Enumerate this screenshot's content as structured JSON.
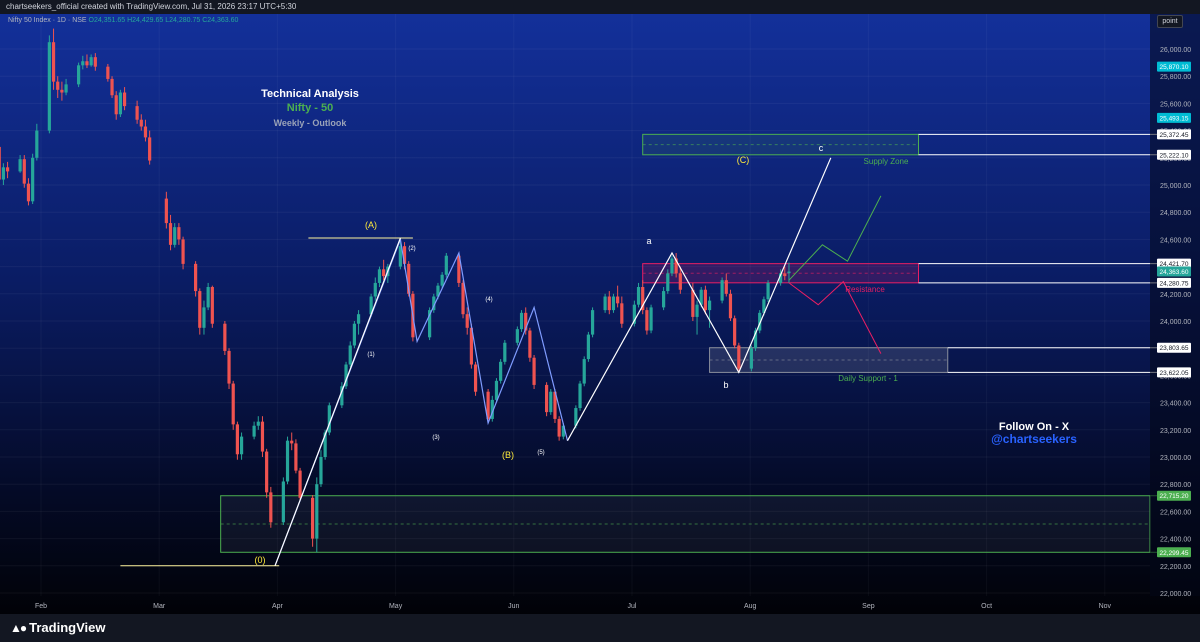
{
  "header": {
    "creator": "chartseekers_official created with TradingView.com, Jul 31, 2026 23:17 UTC+5:30",
    "symbol": "Nifty 50 Index · 1D · NSE",
    "ohlc": "O24,351.65 H24,429.65 L24,280.75 C24,363.60",
    "scale_button": "point"
  },
  "branding": {
    "logo": "TradingView"
  },
  "annotations": {
    "title": "Technical Analysis",
    "subtitle": "Nifty - 50",
    "outlook": "Weekly - Outlook",
    "follow_label": "Follow On - X",
    "follow_handle": "@chartseekers",
    "supply_zone_label": "Supply Zone",
    "resistance_label": "Resistance",
    "support_label": "Daily Support - 1",
    "wave_0": "(0)",
    "wave_A": "(A)",
    "wave_B": "(B)",
    "wave_C": "(C)",
    "wave_a": "a",
    "wave_b": "b",
    "wave_c": "c",
    "sub_1": "(1)",
    "sub_2": "(2)",
    "sub_3": "(3)",
    "sub_4": "(4)",
    "sub_5": "(5)"
  },
  "colors": {
    "up": "#26a69a",
    "down": "#ef5350",
    "wave": "#ffffff",
    "zone_green": "#4caf50",
    "zone_pink": "#e91e63",
    "accent_text": "#4caf50",
    "handle": "#2962ff"
  },
  "chart_data": {
    "type": "candlestick",
    "x_ticks": [
      "Feb",
      "Mar",
      "Apr",
      "May",
      "Jun",
      "Jul",
      "Aug",
      "Sep",
      "Oct",
      "Nov"
    ],
    "y_ticks": [
      "26,000.00",
      "25,800.00",
      "25,600.00",
      "25,400.00",
      "25,200.00",
      "25,000.00",
      "24,800.00",
      "24,600.00",
      "24,400.00",
      "24,200.00",
      "24,000.00",
      "23,800.00",
      "23,600.00",
      "23,400.00",
      "23,200.00",
      "23,000.00",
      "22,800.00",
      "22,600.00",
      "22,400.00",
      "22,200.00",
      "22,000.00"
    ],
    "ylim": [
      21900,
      26300
    ],
    "price_labels": [
      {
        "text": "25,870.10",
        "value": 25870.1,
        "color": "#00bcd4"
      },
      {
        "text": "25,493.15",
        "value": 25493.15,
        "color": "#00bcd4"
      },
      {
        "text": "25,372.45",
        "value": 25372.45,
        "color": "#ffffff"
      },
      {
        "text": "25,222.10",
        "value": 25222.1,
        "color": "#ffffff"
      },
      {
        "text": "24,421.70",
        "value": 24421.7,
        "color": "#ffffff"
      },
      {
        "text": "24,363.60",
        "value": 24363.6,
        "color": "#26a69a"
      },
      {
        "text": "24,280.75",
        "value": 24280.75,
        "color": "#ffffff"
      },
      {
        "text": "23,803.65",
        "value": 23803.65,
        "color": "#ffffff"
      },
      {
        "text": "23,622.05",
        "value": 23622.05,
        "color": "#ffffff"
      },
      {
        "text": "22,715.20",
        "value": 22715.2,
        "color": "#4caf50"
      },
      {
        "text": "22,299.45",
        "value": 22299.45,
        "color": "#4caf50"
      }
    ],
    "zones": [
      {
        "name": "supply",
        "from_date": "2026-06-24",
        "to_date": "2026-08-29",
        "low": 25222.1,
        "high": 25372.45
      },
      {
        "name": "resistance",
        "from_date": "2026-06-24",
        "to_date": "2026-08-29",
        "low": 24280.75,
        "high": 24421.7
      },
      {
        "name": "daily_support_1",
        "from_date": "2026-07-10",
        "to_date": "2026-09-05",
        "low": 23622.05,
        "high": 23803.65
      },
      {
        "name": "base",
        "from_date": "2026-03-15",
        "to_date": "2026-11-30",
        "low": 22299.45,
        "high": 22715.2
      }
    ],
    "candles": [
      [
        "2026-01-19",
        25310,
        25420,
        25180,
        25360
      ],
      [
        "2026-01-20",
        25360,
        25380,
        25250,
        25280
      ],
      [
        "2026-01-21",
        25280,
        25290,
        24950,
        25040
      ],
      [
        "2026-01-22",
        25040,
        25160,
        25000,
        25130
      ],
      [
        "2026-01-23",
        25130,
        25170,
        25050,
        25100
      ],
      [
        "2026-01-26",
        25100,
        25220,
        25090,
        25190
      ],
      [
        "2026-01-27",
        25190,
        25220,
        24980,
        25010
      ],
      [
        "2026-01-28",
        25010,
        25050,
        24850,
        24880
      ],
      [
        "2026-01-29",
        24880,
        25230,
        24860,
        25200
      ],
      [
        "2026-01-30",
        25200,
        25450,
        25180,
        25400
      ],
      [
        "2026-02-02",
        25400,
        26100,
        25380,
        26050
      ],
      [
        "2026-02-03",
        26050,
        26150,
        25700,
        25760
      ],
      [
        "2026-02-04",
        25760,
        25800,
        25640,
        25700
      ],
      [
        "2026-02-05",
        25700,
        25760,
        25620,
        25680
      ],
      [
        "2026-02-06",
        25680,
        25780,
        25660,
        25740
      ],
      [
        "2026-02-09",
        25740,
        25900,
        25720,
        25880
      ],
      [
        "2026-02-10",
        25880,
        25950,
        25850,
        25910
      ],
      [
        "2026-02-11",
        25910,
        25960,
        25860,
        25880
      ],
      [
        "2026-02-12",
        25880,
        25960,
        25870,
        25940
      ],
      [
        "2026-02-13",
        25940,
        25970,
        25840,
        25870
      ],
      [
        "2026-02-16",
        25870,
        25890,
        25760,
        25780
      ],
      [
        "2026-02-17",
        25780,
        25800,
        25640,
        25660
      ],
      [
        "2026-02-18",
        25660,
        25690,
        25480,
        25520
      ],
      [
        "2026-02-19",
        25520,
        25700,
        25500,
        25680
      ],
      [
        "2026-02-20",
        25680,
        25720,
        25550,
        25580
      ],
      [
        "2026-02-23",
        25580,
        25620,
        25450,
        25480
      ],
      [
        "2026-02-24",
        25480,
        25520,
        25400,
        25430
      ],
      [
        "2026-02-25",
        25430,
        25480,
        25320,
        25350
      ],
      [
        "2026-02-26",
        25350,
        25400,
        25150,
        25180
      ],
      [
        "2026-03-02",
        24900,
        24950,
        24680,
        24720
      ],
      [
        "2026-03-03",
        24720,
        24780,
        24520,
        24560
      ],
      [
        "2026-03-04",
        24560,
        24720,
        24540,
        24690
      ],
      [
        "2026-03-05",
        24690,
        24720,
        24560,
        24600
      ],
      [
        "2026-03-06",
        24600,
        24620,
        24380,
        24420
      ],
      [
        "2026-03-09",
        24420,
        24440,
        24180,
        24220
      ],
      [
        "2026-03-10",
        24220,
        24240,
        23900,
        23950
      ],
      [
        "2026-03-11",
        23950,
        24150,
        23900,
        24100
      ],
      [
        "2026-03-12",
        24100,
        24280,
        24080,
        24250
      ],
      [
        "2026-03-13",
        24250,
        24260,
        23950,
        23980
      ],
      [
        "2026-03-16",
        23980,
        24000,
        23750,
        23780
      ],
      [
        "2026-03-17",
        23780,
        23800,
        23500,
        23540
      ],
      [
        "2026-03-18",
        23540,
        23560,
        23200,
        23240
      ],
      [
        "2026-03-19",
        23240,
        23260,
        22980,
        23020
      ],
      [
        "2026-03-20",
        23020,
        23180,
        22980,
        23150
      ],
      [
        "2026-03-23",
        23150,
        23260,
        23130,
        23230
      ],
      [
        "2026-03-24",
        23230,
        23300,
        23200,
        23260
      ],
      [
        "2026-03-25",
        23260,
        23300,
        23000,
        23040
      ],
      [
        "2026-03-26",
        23040,
        23060,
        22700,
        22740
      ],
      [
        "2026-03-27",
        22740,
        22780,
        22480,
        22520
      ],
      [
        "2026-03-30",
        22520,
        22850,
        22500,
        22820
      ],
      [
        "2026-03-31",
        22820,
        23150,
        22800,
        23120
      ],
      [
        "2026-04-01",
        23120,
        23180,
        23050,
        23100
      ],
      [
        "2026-04-02",
        23100,
        23130,
        22880,
        22900
      ],
      [
        "2026-04-03",
        22900,
        22920,
        22680,
        22700
      ],
      [
        "2026-04-06",
        22700,
        22720,
        22340,
        22400
      ],
      [
        "2026-04-07",
        22400,
        22850,
        22299,
        22800
      ],
      [
        "2026-04-08",
        22800,
        23050,
        22780,
        23000
      ],
      [
        "2026-04-09",
        23000,
        23200,
        22980,
        23180
      ],
      [
        "2026-04-10",
        23180,
        23400,
        23160,
        23380
      ],
      [
        "2026-04-13",
        23380,
        23550,
        23360,
        23520
      ],
      [
        "2026-04-14",
        23520,
        23700,
        23500,
        23680
      ],
      [
        "2026-04-15",
        23680,
        23850,
        23660,
        23820
      ],
      [
        "2026-04-16",
        23820,
        24000,
        23800,
        23980
      ],
      [
        "2026-04-17",
        23980,
        24080,
        23900,
        24050
      ],
      [
        "2026-04-20",
        24050,
        24200,
        24030,
        24180
      ],
      [
        "2026-04-21",
        24180,
        24320,
        24150,
        24280
      ],
      [
        "2026-04-22",
        24280,
        24400,
        24250,
        24380
      ],
      [
        "2026-04-23",
        24380,
        24450,
        24300,
        24330
      ],
      [
        "2026-04-24",
        24330,
        24420,
        24280,
        24400
      ],
      [
        "2026-04-27",
        24400,
        24600,
        24380,
        24550
      ],
      [
        "2026-04-28",
        24550,
        24580,
        24380,
        24420
      ],
      [
        "2026-04-29",
        24420,
        24440,
        24180,
        24200
      ],
      [
        "2026-04-30",
        24200,
        24220,
        23850,
        23880
      ],
      [
        "2026-05-04",
        23880,
        24100,
        23860,
        24080
      ],
      [
        "2026-05-05",
        24080,
        24200,
        24060,
        24180
      ],
      [
        "2026-05-06",
        24180,
        24280,
        24160,
        24260
      ],
      [
        "2026-05-07",
        24260,
        24360,
        24240,
        24340
      ],
      [
        "2026-05-08",
        24340,
        24500,
        24320,
        24480
      ],
      [
        "2026-05-11",
        24480,
        24500,
        24250,
        24280
      ],
      [
        "2026-05-12",
        24280,
        24300,
        24020,
        24050
      ],
      [
        "2026-05-13",
        24050,
        24100,
        23900,
        23950
      ],
      [
        "2026-05-14",
        23950,
        23980,
        23650,
        23680
      ],
      [
        "2026-05-15",
        23680,
        23700,
        23450,
        23480
      ],
      [
        "2026-05-18",
        23480,
        23500,
        23250,
        23280
      ],
      [
        "2026-05-19",
        23280,
        23450,
        23260,
        23420
      ],
      [
        "2026-05-20",
        23420,
        23580,
        23400,
        23560
      ],
      [
        "2026-05-21",
        23560,
        23720,
        23540,
        23700
      ],
      [
        "2026-05-22",
        23700,
        23860,
        23680,
        23840
      ],
      [
        "2026-05-25",
        23840,
        23960,
        23820,
        23940
      ],
      [
        "2026-05-26",
        23940,
        24080,
        23920,
        24060
      ],
      [
        "2026-05-27",
        24060,
        24100,
        23900,
        23930
      ],
      [
        "2026-05-28",
        23930,
        23950,
        23700,
        23730
      ],
      [
        "2026-05-29",
        23730,
        23750,
        23500,
        23530
      ],
      [
        "2026-06-01",
        23530,
        23550,
        23300,
        23330
      ],
      [
        "2026-06-02",
        23330,
        23500,
        23310,
        23480
      ],
      [
        "2026-06-03",
        23480,
        23500,
        23250,
        23280
      ],
      [
        "2026-06-04",
        23280,
        23300,
        23120,
        23150
      ],
      [
        "2026-06-05",
        23150,
        23250,
        23130,
        23230
      ],
      [
        "2026-06-08",
        23230,
        23380,
        23210,
        23360
      ],
      [
        "2026-06-09",
        23360,
        23560,
        23340,
        23540
      ],
      [
        "2026-06-10",
        23540,
        23740,
        23520,
        23720
      ],
      [
        "2026-06-11",
        23720,
        23920,
        23700,
        23900
      ],
      [
        "2026-06-12",
        23900,
        24100,
        23880,
        24080
      ],
      [
        "2026-06-15",
        24080,
        24200,
        24060,
        24180
      ],
      [
        "2026-06-16",
        24180,
        24220,
        24050,
        24080
      ],
      [
        "2026-06-17",
        24080,
        24200,
        24060,
        24180
      ],
      [
        "2026-06-18",
        24180,
        24260,
        24100,
        24130
      ],
      [
        "2026-06-19",
        24130,
        24180,
        23950,
        23980
      ],
      [
        "2026-06-22",
        23980,
        24150,
        23960,
        24120
      ],
      [
        "2026-06-23",
        24120,
        24280,
        24100,
        24250
      ],
      [
        "2026-06-24",
        24250,
        24300,
        24050,
        24080
      ],
      [
        "2026-06-25",
        24080,
        24100,
        23900,
        23930
      ],
      [
        "2026-06-26",
        23930,
        24120,
        23910,
        24100
      ],
      [
        "2026-06-29",
        24100,
        24250,
        24080,
        24220
      ],
      [
        "2026-06-30",
        24220,
        24380,
        24200,
        24350
      ],
      [
        "2026-07-01",
        24350,
        24480,
        24330,
        24460
      ],
      [
        "2026-07-02",
        24460,
        24500,
        24320,
        24350
      ],
      [
        "2026-07-03",
        24350,
        24400,
        24200,
        24230
      ],
      [
        "2026-07-06",
        24230,
        24280,
        24000,
        24030
      ],
      [
        "2026-07-07",
        24030,
        24150,
        23900,
        24120
      ],
      [
        "2026-07-08",
        24120,
        24250,
        24100,
        24230
      ],
      [
        "2026-07-09",
        24230,
        24260,
        24050,
        24080
      ],
      [
        "2026-07-10",
        24080,
        24180,
        23950,
        24150
      ],
      [
        "2026-07-13",
        24150,
        24320,
        24130,
        24300
      ],
      [
        "2026-07-14",
        24300,
        24350,
        24180,
        24200
      ],
      [
        "2026-07-15",
        24200,
        24230,
        24000,
        24020
      ],
      [
        "2026-07-16",
        24020,
        24040,
        23800,
        23820
      ],
      [
        "2026-07-17",
        23820,
        23840,
        23622,
        23650
      ],
      [
        "2026-07-20",
        23650,
        23820,
        23630,
        23800
      ],
      [
        "2026-07-21",
        23800,
        23950,
        23780,
        23930
      ],
      [
        "2026-07-22",
        23930,
        24080,
        23910,
        24060
      ],
      [
        "2026-07-23",
        24060,
        24180,
        24040,
        24160
      ],
      [
        "2026-07-24",
        24160,
        24300,
        24140,
        24280
      ],
      [
        "2026-07-27",
        24280,
        24380,
        24260,
        24350
      ],
      [
        "2026-07-28",
        24350,
        24400,
        24300,
        24330
      ],
      [
        "2026-07-29",
        24351.65,
        24429.65,
        24280.75,
        24363.6
      ]
    ]
  }
}
